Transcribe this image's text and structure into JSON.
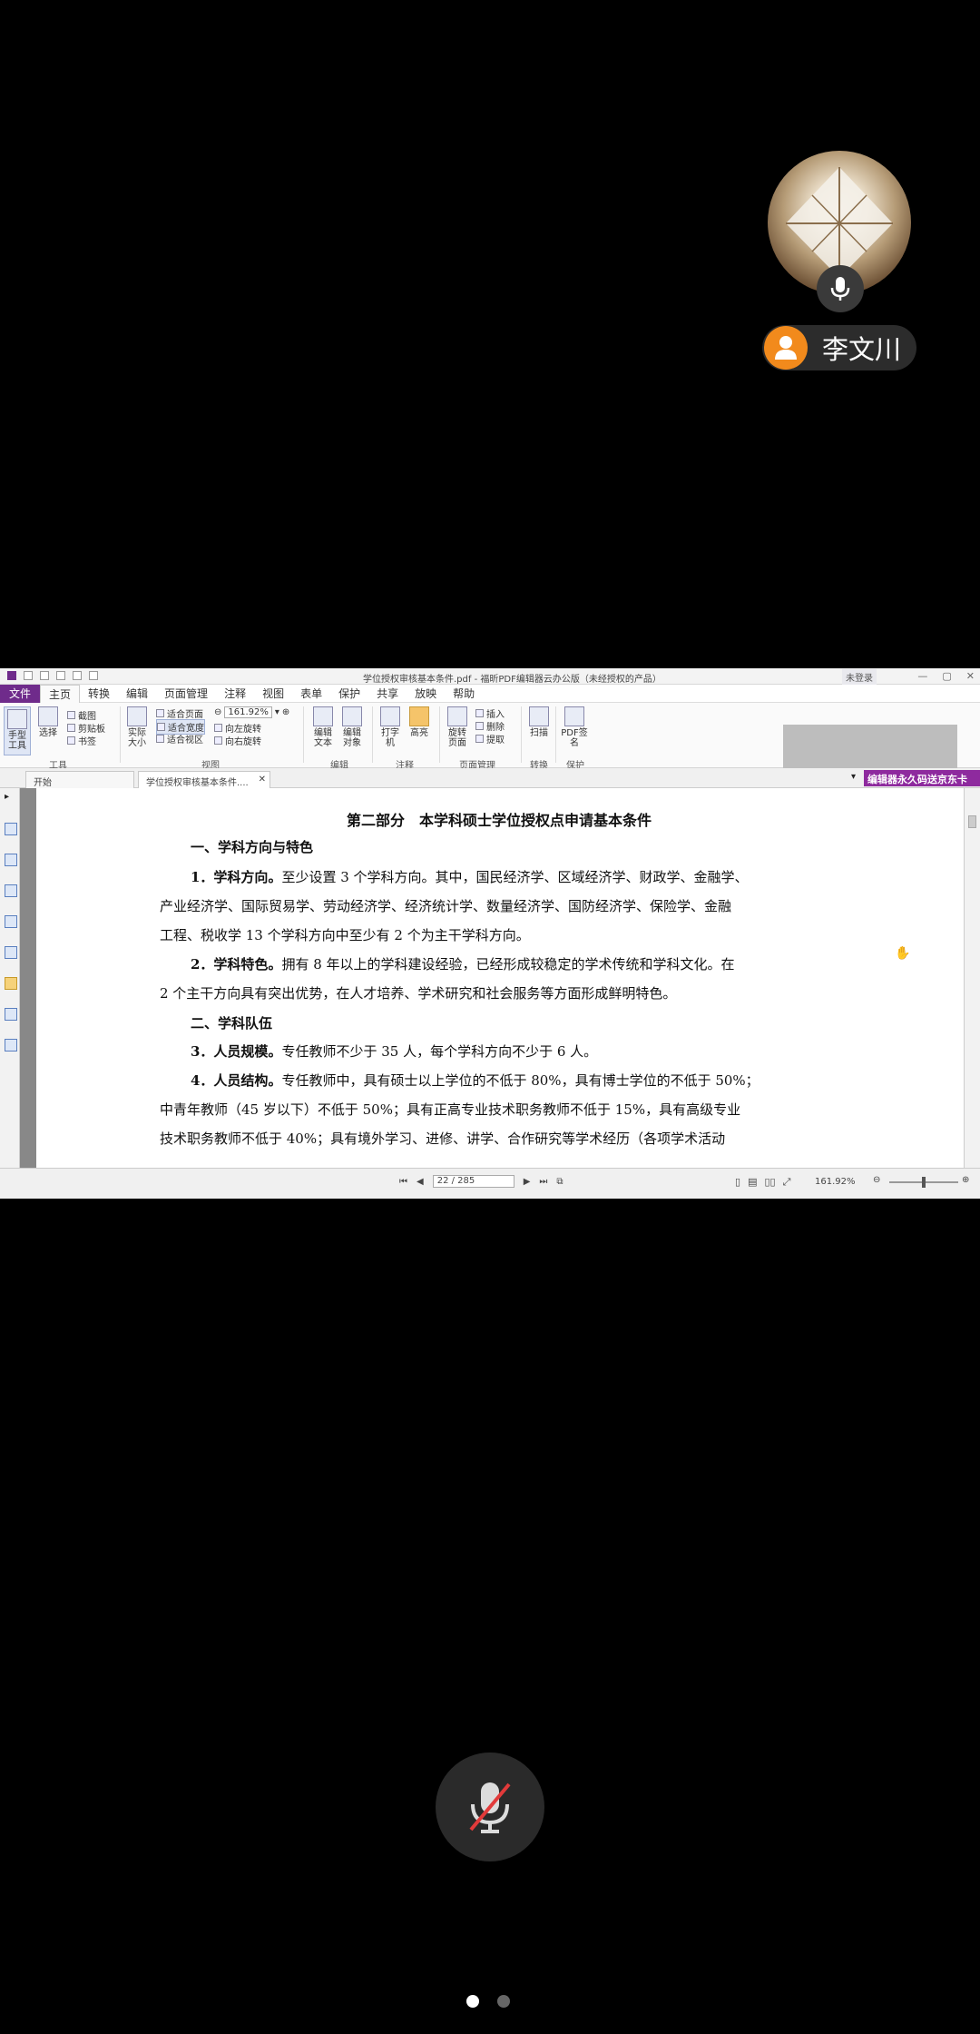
{
  "participant": {
    "name": "李文川"
  },
  "app": {
    "window_title": "学位授权审核基本条件.pdf - 福昕PDF编辑器云办公版（未经授权的产品）",
    "login_button": "未登录",
    "menu": [
      "文件",
      "主页",
      "转换",
      "编辑",
      "页面管理",
      "注释",
      "视图",
      "表单",
      "保护",
      "共享",
      "放映",
      "帮助"
    ],
    "ribbon": {
      "hand_tool": "手型工具",
      "select": "选择",
      "snapshot": "截图",
      "clipboard": "剪贴板",
      "bookmark": "书签",
      "actual_size": "实际大小",
      "fit_page": "适合页面",
      "fit_width": "适合宽度",
      "fit_visible": "适合视区",
      "zoom_value": "161.92%",
      "rotate_left": "向左旋转",
      "rotate_right": "向右旋转",
      "edit_text": "编辑文本",
      "edit_object": "编辑对象",
      "typewriter": "打字机",
      "highlight": "高亮",
      "rotate_page": "旋转页面",
      "insert": "插入",
      "delete": "删除",
      "extract": "提取",
      "scan": "扫描",
      "pdf_sign": "PDF签名",
      "groups": [
        "工具",
        "视图",
        "编辑",
        "注释",
        "页面管理",
        "转换",
        "保护"
      ]
    },
    "tabs": [
      "开始",
      "学位授权审核基本条件...."
    ],
    "promo": "编辑器永久码送京东卡",
    "page_indicator": "22 / 285",
    "zoom_status": "161.92%"
  },
  "document": {
    "title": "第二部分　本学科硕士学位授权点申请基本条件",
    "section1": "一、学科方向与特色",
    "p1_label": "1．学科方向。",
    "p1_lines": [
      "至少设置 3 个学科方向。其中，国民经济学、区域经济学、财政学、金融学、",
      "产业经济学、国际贸易学、劳动经济学、经济统计学、数量经济学、国防经济学、保险学、金融",
      "工程、税收学 13 个学科方向中至少有 2 个为主干学科方向。"
    ],
    "p2_label": "2．学科特色。",
    "p2_lines": [
      "拥有 8 年以上的学科建设经验，已经形成较稳定的学术传统和学科文化。在",
      "2 个主干方向具有突出优势，在人才培养、学术研究和社会服务等方面形成鲜明特色。"
    ],
    "section2": "二、学科队伍",
    "p3_label": "3．人员规模。",
    "p3_line": "专任教师不少于 35 人，每个学科方向不少于 6 人。",
    "p4_label": "4．人员结构。",
    "p4_lines": [
      "专任教师中，具有硕士以上学位的不低于 80%，具有博士学位的不低于 50%；",
      "中青年教师（45 岁以下）不低于 50%；具有正高专业技术职务教师不低于 15%，具有高级专业",
      "技术职务教师不低于  40%；具有境外学习、进修、讲学、合作研究等学术经历（各项学术活动"
    ]
  }
}
